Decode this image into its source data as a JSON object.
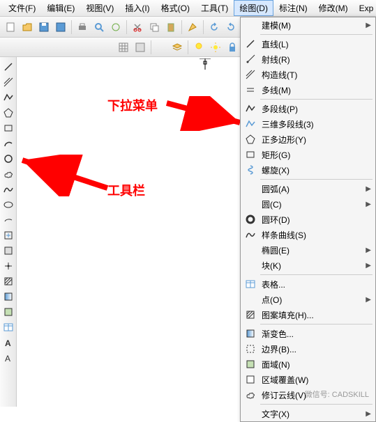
{
  "menubar": {
    "items": [
      {
        "label": "文件(F)"
      },
      {
        "label": "编辑(E)"
      },
      {
        "label": "视图(V)"
      },
      {
        "label": "插入(I)"
      },
      {
        "label": "格式(O)"
      },
      {
        "label": "工具(T)"
      },
      {
        "label": "绘图(D)",
        "active": true
      },
      {
        "label": "标注(N)"
      },
      {
        "label": "修改(M)"
      },
      {
        "label": "Exp"
      }
    ]
  },
  "dropdown": {
    "groups": [
      [
        {
          "label": "建模(M)",
          "icon": "",
          "sub": true
        }
      ],
      [
        {
          "label": "直线(L)",
          "icon": "line"
        },
        {
          "label": "射线(R)",
          "icon": "ray"
        },
        {
          "label": "构造线(T)",
          "icon": "xline"
        },
        {
          "label": "多线(M)",
          "icon": "mline"
        }
      ],
      [
        {
          "label": "多段线(P)",
          "icon": "pline"
        },
        {
          "label": "三维多段线(3)",
          "icon": "3dpoly"
        },
        {
          "label": "正多边形(Y)",
          "icon": "polygon"
        },
        {
          "label": "矩形(G)",
          "icon": "rect"
        },
        {
          "label": "螺旋(X)",
          "icon": "helix"
        }
      ],
      [
        {
          "label": "圆弧(A)",
          "icon": "",
          "sub": true
        },
        {
          "label": "圆(C)",
          "icon": "",
          "sub": true
        },
        {
          "label": "圆环(D)",
          "icon": "donut"
        },
        {
          "label": "样条曲线(S)",
          "icon": "spline"
        },
        {
          "label": "椭圆(E)",
          "icon": "",
          "sub": true
        },
        {
          "label": "块(K)",
          "icon": "",
          "sub": true
        }
      ],
      [
        {
          "label": "表格...",
          "icon": "table"
        },
        {
          "label": "点(O)",
          "icon": "",
          "sub": true
        },
        {
          "label": "图案填充(H)...",
          "icon": "hatch"
        }
      ],
      [
        {
          "label": "渐变色...",
          "icon": "gradient"
        },
        {
          "label": "边界(B)...",
          "icon": "boundary"
        },
        {
          "label": "面域(N)",
          "icon": "region"
        },
        {
          "label": "区域覆盖(W)",
          "icon": "wipeout"
        },
        {
          "label": "修订云线(V)",
          "icon": "revcloud"
        }
      ],
      [
        {
          "label": "文字(X)",
          "icon": "",
          "sub": true
        }
      ]
    ]
  },
  "annotations": {
    "dropdown_label": "下拉菜单",
    "toolbar_label": "工具栏"
  },
  "watermark": "微信号: CADSKILL",
  "side_tools": [
    "line",
    "xline",
    "pline",
    "polygon",
    "rect",
    "arc",
    "circle",
    "revcloud",
    "spline",
    "ellipse",
    "earc",
    "insert",
    "block",
    "point",
    "hatch",
    "gradient",
    "region",
    "table",
    "mtext",
    "text2"
  ]
}
